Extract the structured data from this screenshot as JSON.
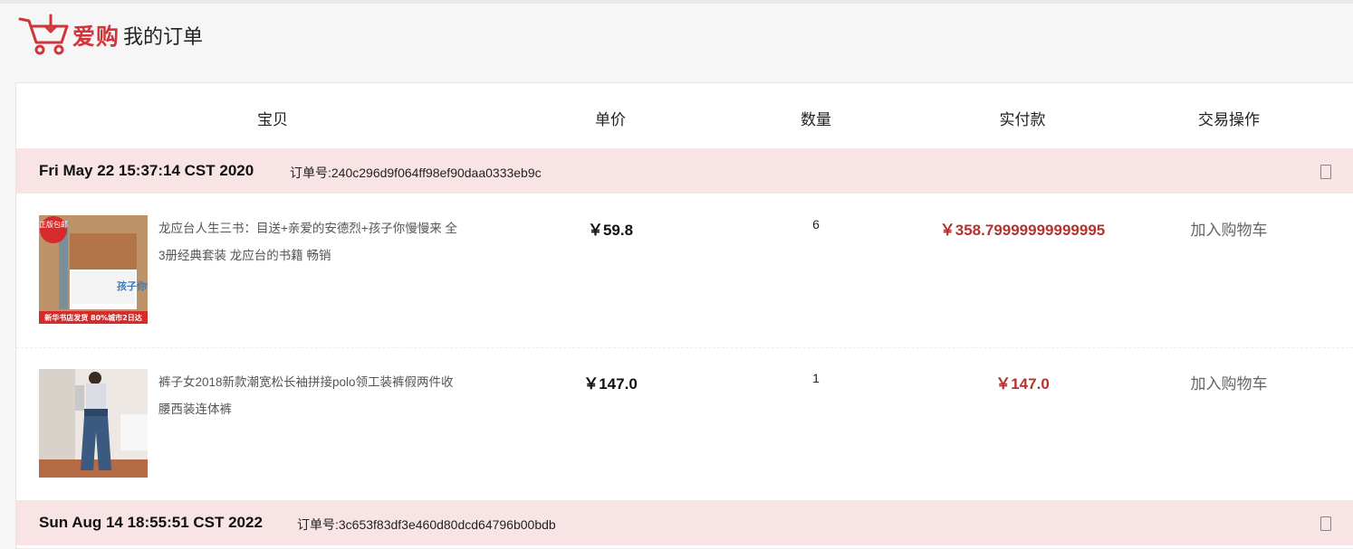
{
  "brand": {
    "logo_text": "爱购",
    "page_title": "我的订单",
    "accent_color": "#d0353c"
  },
  "table_headers": {
    "item": "宝贝",
    "unit_price": "单价",
    "quantity": "数量",
    "paid": "实付款",
    "actions": "交易操作"
  },
  "orders": [
    {
      "date": "Fri May 22 15:37:14 CST 2020",
      "order_no": "订单号:240c296d9f064ff98ef90daa0333eb9c",
      "delete_icon": "trash-icon",
      "items": [
        {
          "title": "龙应台人生三书：目送+亲爱的安德烈+孩子你慢慢来 全3册经典套装 龙应台的书籍 畅销",
          "thumb_badge": "正版包邮",
          "thumb_caption": "新华书店发货 80%城市2日达",
          "thumb_book_title": "孩子你慢慢来",
          "unit_price": "￥59.8",
          "quantity": "6",
          "paid": "￥358.79999999999995",
          "action": "加入购物车"
        },
        {
          "title": "裤子女2018新款潮宽松长袖拼接polo领工装裤假两件收腰西装连体裤",
          "unit_price": "￥147.0",
          "quantity": "1",
          "paid": "￥147.0",
          "action": "加入购物车"
        }
      ]
    },
    {
      "date": "Sun Aug 14 18:55:51 CST 2022",
      "order_no": "订单号:3c653f83df3e460d80dcd64796b00bdb",
      "delete_icon": "trash-icon",
      "items": []
    }
  ]
}
